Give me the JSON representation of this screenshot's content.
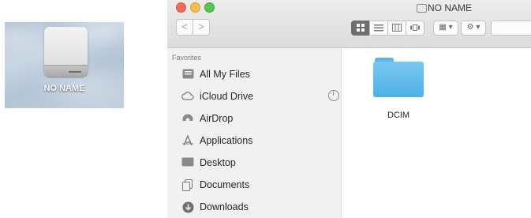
{
  "desktop": {
    "drive_label": "NO NAME",
    "drive_icon": "external-drive-icon"
  },
  "window": {
    "title": "NO NAME",
    "title_icon": "external-drive-icon",
    "traffic_lights": [
      "close",
      "minimize",
      "zoom"
    ],
    "nav": {
      "back_glyph": "<",
      "forward_glyph": ">"
    },
    "toolbar": {
      "view_modes": [
        "icon-view",
        "list-view",
        "column-view",
        "cover-flow-view"
      ],
      "active_view": "icon-view",
      "arrange_glyph": "▦ ▾",
      "action_glyph": "⚙ ▾"
    }
  },
  "sidebar": {
    "section_title": "Favorites",
    "items": [
      {
        "label": "All My Files",
        "icon": "all-files-icon"
      },
      {
        "label": "iCloud Drive",
        "icon": "cloud-icon"
      },
      {
        "label": "AirDrop",
        "icon": "airdrop-icon"
      },
      {
        "label": "Applications",
        "icon": "applications-icon"
      },
      {
        "label": "Desktop",
        "icon": "desktop-icon"
      },
      {
        "label": "Documents",
        "icon": "documents-icon"
      },
      {
        "label": "Downloads",
        "icon": "downloads-icon"
      }
    ]
  },
  "content": {
    "items": [
      {
        "name": "DCIM",
        "icon": "folder-icon"
      }
    ]
  },
  "colors": {
    "folder_blue": "#5bb6e6",
    "close_red": "#f26b5b",
    "minimize_yellow": "#f6be4f",
    "zoom_green": "#5ac451"
  }
}
